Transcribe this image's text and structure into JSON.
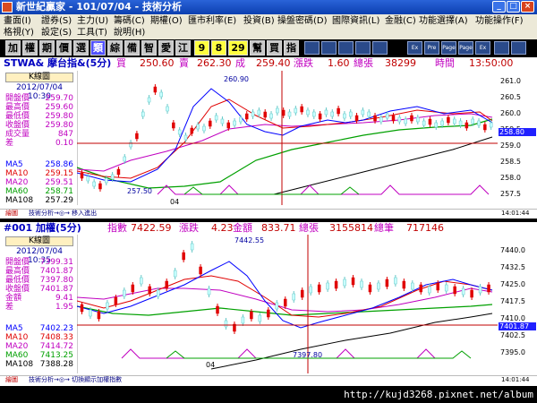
{
  "window": {
    "title": "新世紀贏家 - 101/07/04 - 技術分析",
    "min": "_",
    "max": "□",
    "close": "×"
  },
  "menu": {
    "row1": [
      "畫面(I)",
      "證券(S)",
      "主力(U)",
      "籌碼(C)",
      "期權(O)",
      "匯市利率(E)",
      "投資(B)",
      "操盤密碼(D)",
      "國際資訊(L)",
      "金融(C)",
      "功能選擇(A)",
      "功能操作(F)"
    ],
    "row2": [
      "格視(Y)",
      "設定(S)",
      "工具(T)",
      "說明(H)"
    ]
  },
  "toolbar": {
    "buttons": [
      "加",
      "權",
      "期",
      "價",
      "選",
      "類",
      "綜",
      "備",
      "智",
      "愛",
      "江"
    ],
    "selected_index": 5,
    "nums": [
      "9",
      "8",
      "29"
    ],
    "buttons2": [
      "幫",
      "買",
      "指"
    ],
    "icon_buttons": [
      "Ex",
      "Pre",
      "Page",
      "Page",
      "Ex"
    ]
  },
  "colors": {
    "up": "#e00000",
    "down": "#c8ffff",
    "ma5": "#0000ff",
    "ma10": "#e00000",
    "ma20": "#c000c0",
    "ma60": "#00a000",
    "ma108": "#000000",
    "cross": "#c00000",
    "price_tag": "#2020ff"
  },
  "panel1": {
    "header": {
      "symbol": "STWA& 摩台指&(5分)",
      "buy_label": "買",
      "buy": "250.60",
      "sell_label": "賣",
      "sell": "262.30",
      "deal_label": "成",
      "deal": "259.40",
      "change_label": "漲跌",
      "change": "1.60",
      "vol_label": "總張",
      "vol": "38299",
      "time_label": "時間",
      "time": "13:50:00"
    },
    "k_label": "K線圖",
    "date": "2012/07/04 10:30",
    "info": [
      [
        "開盤價",
        "259.70"
      ],
      [
        "最高價",
        "259.60"
      ],
      [
        "最低價",
        "259.80"
      ],
      [
        "收盤價",
        "259.80"
      ],
      [
        "成交量",
        "847"
      ],
      [
        "差",
        "0.10"
      ]
    ],
    "ma": [
      [
        "MA5",
        "258.86"
      ],
      [
        "MA10",
        "259.15"
      ],
      [
        "MA20",
        "259.51"
      ],
      [
        "MA60",
        "258.71"
      ],
      [
        "MA108",
        "257.29"
      ]
    ],
    "scale": [
      "261.0",
      "260.5",
      "260.0",
      "259.5",
      "259.0",
      "258.5",
      "258.0",
      "257.5"
    ],
    "price_tag": "258.80",
    "high_label": "260.90",
    "low_label": "257.50",
    "date_tick": "04",
    "footer_left": "繪圖",
    "footer_mid": "技術分析→◎→ 移入進出",
    "footer_time": "14:01:44"
  },
  "panel2": {
    "header": {
      "symbol": "#001 加權(5分)",
      "idx_label": "指數",
      "idx": "7422.59",
      "change_label": "漲跌",
      "change": "4.23",
      "amt_label": "金額",
      "amt": "833.71",
      "vol_label": "總張",
      "vol": "3155814",
      "cnt_label": "總筆",
      "cnt": "717146"
    },
    "k_label": "K線圖",
    "date": "2012/07/04 10:35",
    "info": [
      [
        "開盤價",
        "7399.31"
      ],
      [
        "最高價",
        "7401.87"
      ],
      [
        "最低價",
        "7397.80"
      ],
      [
        "收盤價",
        "7401.87"
      ],
      [
        "金額",
        "9.41"
      ],
      [
        "差",
        "1.95"
      ]
    ],
    "ma": [
      [
        "MA5",
        "7402.23"
      ],
      [
        "MA10",
        "7408.33"
      ],
      [
        "MA20",
        "7414.72"
      ],
      [
        "MA60",
        "7413.25"
      ],
      [
        "MA108",
        "7388.28"
      ]
    ],
    "scale": [
      "7440.0",
      "7432.5",
      "7425.0",
      "7417.5",
      "7410.0",
      "7402.5",
      "7395.0"
    ],
    "price_tag": "7401.87",
    "high_label": "7442.55",
    "low_label": "7397.80",
    "date_tick": "04",
    "footer_left": "繪圖",
    "footer_mid": "技術分析→◎→ 切換顯示加權指數",
    "footer_time": "14:01:44"
  },
  "status": {
    "url": "http://kujd3268.pixnet.net/album"
  }
}
